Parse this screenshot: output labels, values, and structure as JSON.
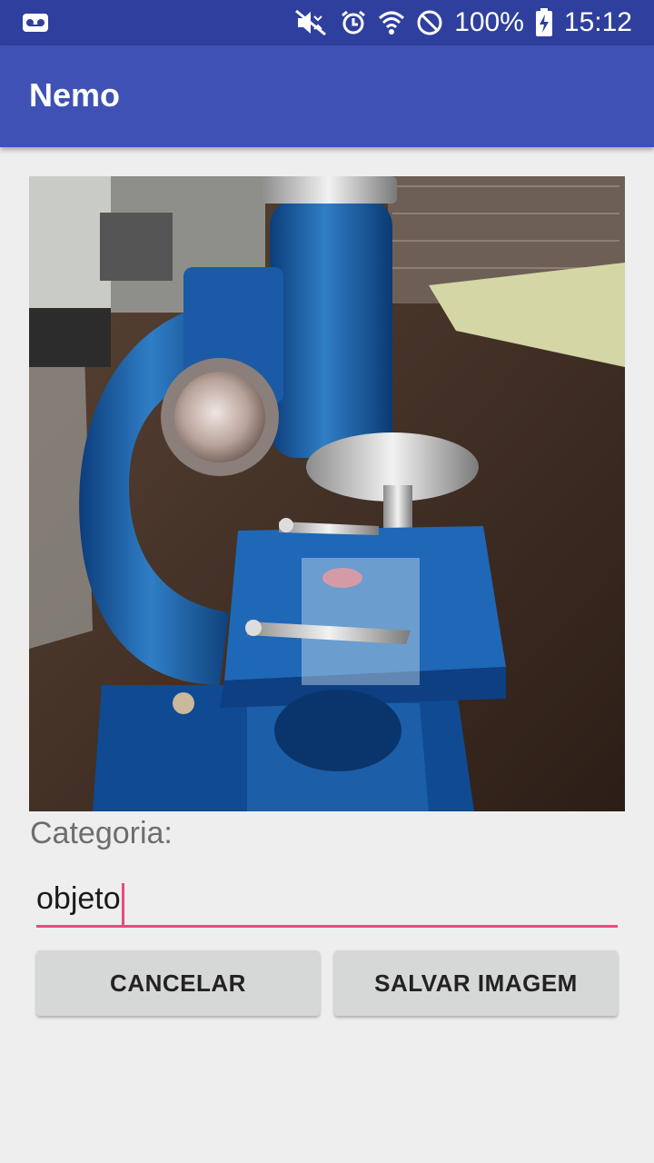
{
  "status_bar": {
    "battery": "100%",
    "time": "15:12",
    "icons": [
      "voicemail-icon",
      "mute-icon",
      "alarm-icon",
      "wifi-icon",
      "do-not-disturb-icon",
      "battery-charging-icon"
    ]
  },
  "app_bar": {
    "title": "Nemo"
  },
  "main": {
    "image": "microscope-photo",
    "category_label": "Categoria:",
    "category_value": "objeto"
  },
  "buttons": {
    "cancel_label": "CANCELAR",
    "save_label": "SALVAR IMAGEM"
  },
  "colors": {
    "primary": "#3f51b5",
    "primary_dark": "#2f3f9e",
    "accent": "#e84a7f",
    "background": "#eeeeee",
    "button": "#d6d7d7"
  }
}
